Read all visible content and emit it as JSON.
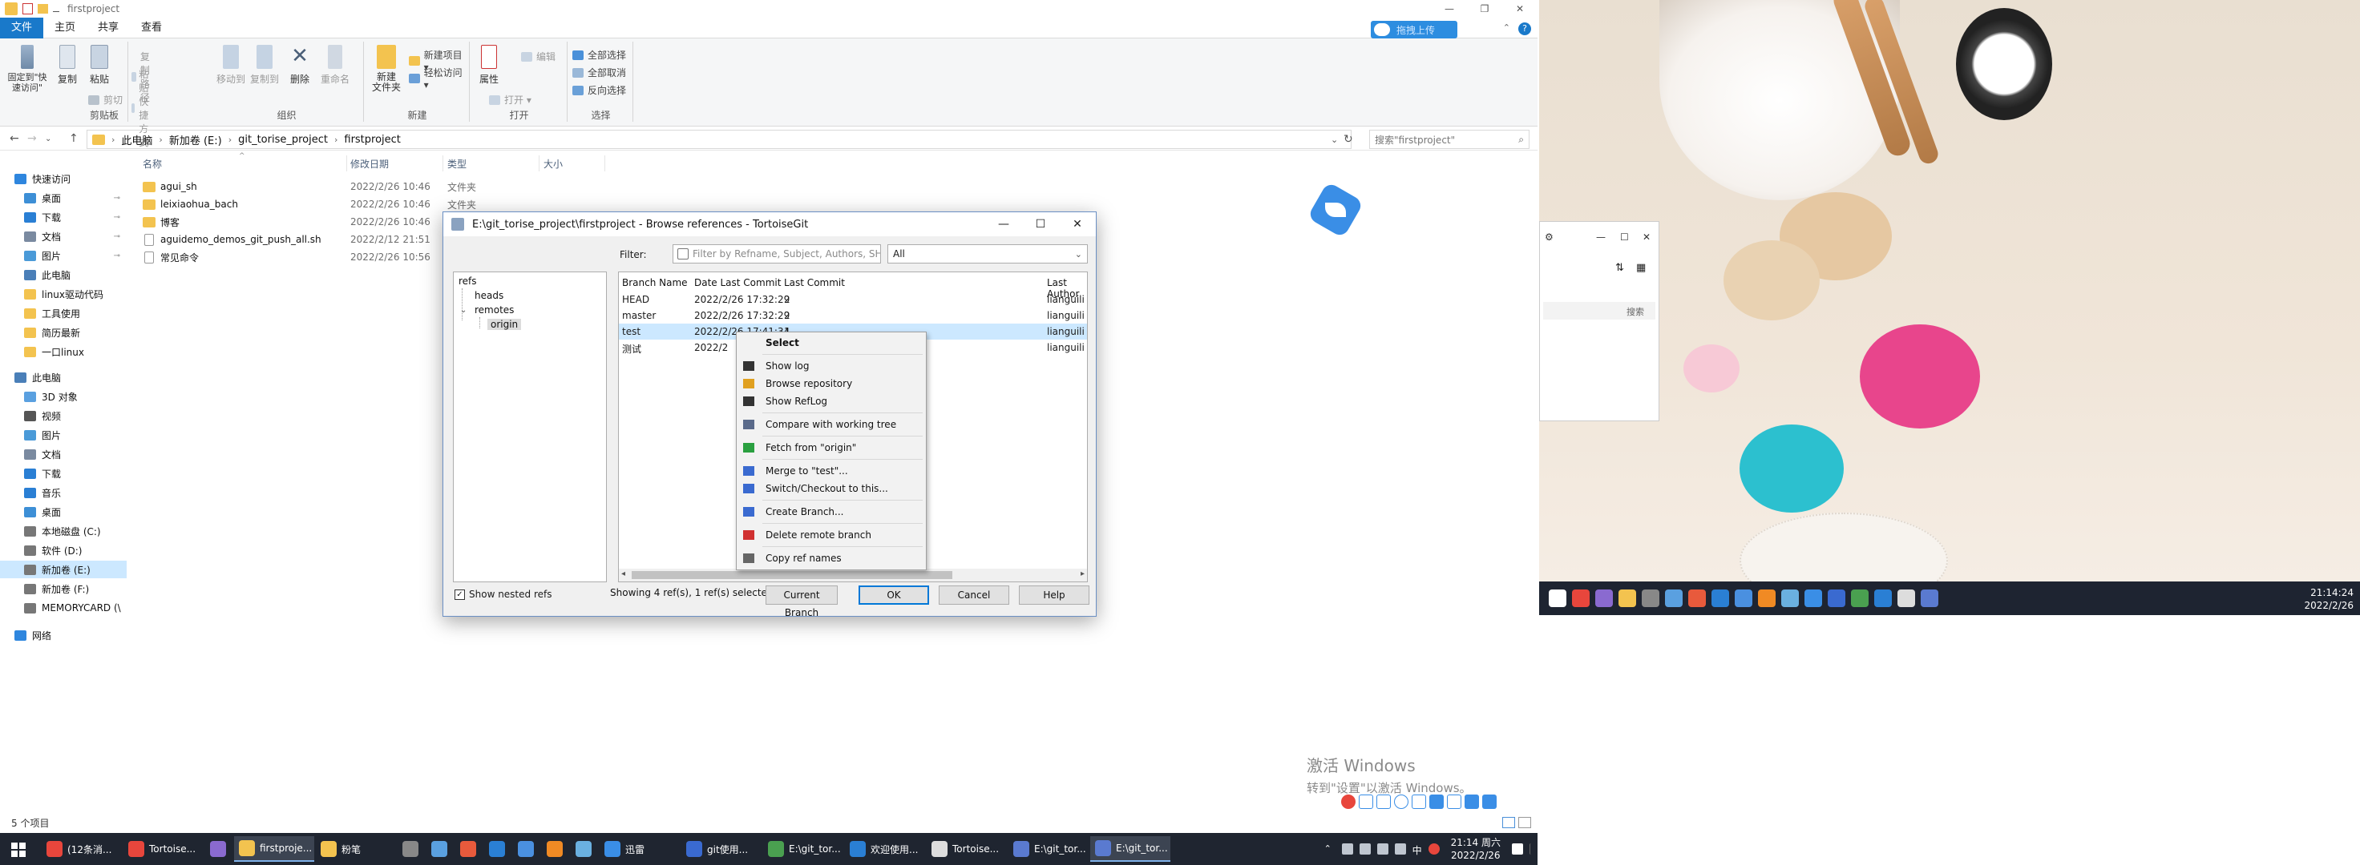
{
  "explorer": {
    "title": "firstproject",
    "window_controls": [
      "—",
      "❐",
      "✕"
    ],
    "tabs": [
      "文件",
      "主页",
      "共享",
      "查看"
    ],
    "upload_label": "拖拽上传",
    "ribbon": {
      "clipboard": {
        "pin": "固定到\"快速访问\"",
        "copy": "复制",
        "paste": "粘贴",
        "copy_path": "复制路径",
        "paste_shortcut": "粘贴快捷方式",
        "cut": "剪切",
        "label": "剪贴板"
      },
      "organize": {
        "move_to": "移动到",
        "copy_to": "复制到",
        "delete": "删除",
        "rename": "重命名",
        "label": "组织"
      },
      "new": {
        "new_folder": "新建\n文件夹",
        "new_item": "新建项目 ▾",
        "easy_access": "轻松访问 ▾",
        "label": "新建"
      },
      "open": {
        "properties": "属性",
        "open": "打开 ▾",
        "edit": "编辑",
        "label": "打开"
      },
      "select": {
        "select_all": "全部选择",
        "select_none": "全部取消",
        "invert": "反向选择",
        "label": "选择"
      }
    },
    "address": {
      "crumbs": [
        "此电脑",
        "新加卷 (E:)",
        "git_torise_project",
        "firstproject"
      ],
      "search_placeholder": "搜索\"firstproject\""
    },
    "nav": [
      {
        "label": "快速访问",
        "color": "#2e86de"
      },
      {
        "label": "桌面",
        "color": "#3d8fd6",
        "pin": "📌"
      },
      {
        "label": "下载",
        "color": "#2a7fd4",
        "pin": "📌"
      },
      {
        "label": "文档",
        "color": "#7a8aa0",
        "pin": "📌"
      },
      {
        "label": "图片",
        "color": "#4a9ad8",
        "pin": "📌"
      },
      {
        "label": "此电脑",
        "color": "#4a7fb8"
      },
      {
        "label": "linux驱动代码",
        "color": "#f3c34f"
      },
      {
        "label": "工具使用",
        "color": "#f3c34f"
      },
      {
        "label": "简历最新",
        "color": "#f3c34f"
      },
      {
        "label": "一口linux",
        "color": "#f3c34f"
      },
      {
        "label": "此电脑",
        "color": "#4a7fb8"
      },
      {
        "label": "3D 对象",
        "color": "#5aa0e0"
      },
      {
        "label": "视频",
        "color": "#555"
      },
      {
        "label": "图片",
        "color": "#4a9ad8"
      },
      {
        "label": "文档",
        "color": "#7a8aa0"
      },
      {
        "label": "下载",
        "color": "#2a7fd4"
      },
      {
        "label": "音乐",
        "color": "#2a7fd4"
      },
      {
        "label": "桌面",
        "color": "#3d8fd6"
      },
      {
        "label": "本地磁盘 (C:)",
        "color": "#777"
      },
      {
        "label": "软件 (D:)",
        "color": "#777"
      },
      {
        "label": "新加卷 (E:)",
        "color": "#777"
      },
      {
        "label": "新加卷 (F:)",
        "color": "#777"
      },
      {
        "label": "MEMORYCARD (\\",
        "color": "#777"
      },
      {
        "label": "网络",
        "color": "#2e86de"
      }
    ],
    "columns": [
      "名称",
      "修改日期",
      "类型",
      "大小"
    ],
    "files": [
      {
        "name": "agui_sh",
        "date": "2022/2/26 10:46",
        "type": "文件夹",
        "kind": "folder"
      },
      {
        "name": "leixiaohua_bach",
        "date": "2022/2/26 10:46",
        "type": "文件夹",
        "kind": "folder"
      },
      {
        "name": "博客",
        "date": "2022/2/26 10:46",
        "type": "文件夹",
        "kind": "folder"
      },
      {
        "name": "aguidemo_demos_git_push_all.sh",
        "date": "2022/2/12 21:51",
        "type": "",
        "kind": "file"
      },
      {
        "name": "常见命令",
        "date": "2022/2/26 10:56",
        "type": "",
        "kind": "file"
      }
    ],
    "status": "5 个项目",
    "watermark": {
      "line1": "激活 Windows",
      "line2": "转到\"设置\"以激活 Windows。"
    }
  },
  "dialog": {
    "title": "E:\\git_torise_project\\firstproject - Browse references - TortoiseGit",
    "tree": {
      "root": "refs",
      "heads": "heads",
      "remotes": "remotes",
      "origin": "origin"
    },
    "filter_label": "Filter:",
    "filter_placeholder": "Filter by Refname, Subject, Authors, SHA",
    "filter_scope": "All",
    "columns": [
      "Branch Name",
      "Date Last Commit",
      "Last Commit",
      "Last Author"
    ],
    "rows": [
      {
        "name": "HEAD",
        "date": "2022/2/26 17:32:29",
        "commit": "2",
        "author": "lianguili"
      },
      {
        "name": "master",
        "date": "2022/2/26 17:32:29",
        "commit": "2",
        "author": "lianguili"
      },
      {
        "name": "test",
        "date": "2022/2/26 17:41:34",
        "commit": "1",
        "author": "lianguili",
        "selected": true
      },
      {
        "name": "测试",
        "date": "2022/2",
        "commit": "",
        "author": "lianguili"
      }
    ],
    "show_nested": "Show nested refs",
    "showing": "Showing 4 ref(s), 1 ref(s) selected",
    "buttons": {
      "current_branch": "Current Branch",
      "ok": "OK",
      "cancel": "Cancel",
      "help": "Help"
    }
  },
  "context_menu": {
    "items": [
      {
        "label": "Select",
        "icon": "none",
        "bold": true
      },
      {
        "label": "Show log",
        "icon": "log-icon",
        "color": "#333"
      },
      {
        "label": "Browse repository",
        "icon": "repo-browser-icon",
        "color": "#e0a020"
      },
      {
        "label": "Show RefLog",
        "icon": "reflog-icon",
        "color": "#333"
      },
      {
        "label": "Compare with working tree",
        "icon": "compare-icon",
        "color": "#5a6a8a"
      },
      {
        "label": "Fetch from \"origin\"",
        "icon": "fetch-icon",
        "color": "#2aa040"
      },
      {
        "label": "Merge to \"test\"...",
        "icon": "merge-icon",
        "color": "#3a6ad0"
      },
      {
        "label": "Switch/Checkout to this...",
        "icon": "checkout-icon",
        "color": "#3a6ad0"
      },
      {
        "label": "Create Branch...",
        "icon": "create-branch-icon",
        "color": "#3a6ad0"
      },
      {
        "label": "Delete remote branch",
        "icon": "delete-icon",
        "color": "#d03030"
      },
      {
        "label": "Copy ref names",
        "icon": "copy-icon",
        "color": "#666"
      }
    ]
  },
  "taskbar": {
    "apps": [
      {
        "label": "(12条消...",
        "color": "#e8463c"
      },
      {
        "label": "Tortoise...",
        "color": "#e8463c"
      },
      {
        "label": "",
        "color": "#8a6ad0"
      },
      {
        "label": "firstproje...",
        "color": "#f3c34f",
        "active": true
      },
      {
        "label": "粉笔",
        "color": "#f3c34f"
      },
      {
        "label": "",
        "color": "#888"
      },
      {
        "label": "",
        "color": "#5aa0e0"
      },
      {
        "label": "",
        "color": "#e85a3c"
      },
      {
        "label": "",
        "color": "#2a7fd4"
      },
      {
        "label": "",
        "color": "#4a90e0"
      },
      {
        "label": "",
        "color": "#f08a24"
      },
      {
        "label": "",
        "color": "#6ab0e0"
      },
      {
        "label": "迅雷",
        "color": "#3a8ee6"
      },
      {
        "label": "git使用...",
        "color": "#3a6ad0"
      },
      {
        "label": "E:\\git_tor...",
        "color": "#4aa050"
      },
      {
        "label": "欢迎使用...",
        "color": "#2a7fd4"
      },
      {
        "label": "Tortoise...",
        "color": "#ddd"
      },
      {
        "label": "E:\\git_tor...",
        "color": "#5a7ad0"
      },
      {
        "label": "E:\\git_tor...",
        "color": "#5a7ad0",
        "active": true
      }
    ],
    "clock_time": "21:14 周六",
    "clock_date": "2022/2/26",
    "ime": "中"
  },
  "right_screen": {
    "small_window_search": "搜索",
    "clock_time": "21:14:24",
    "clock_date": "2022/2/26",
    "taskbar_icons": [
      "#fff",
      "#e8463c",
      "#8a6ad0",
      "#f3c34f",
      "#888",
      "#5aa0e0",
      "#e85a3c",
      "#2a7fd4",
      "#4a90e0",
      "#f08a24",
      "#6ab0e0",
      "#3a8ee6",
      "#3a6ad0",
      "#4aa050",
      "#2a7fd4",
      "#ddd",
      "#5a7ad0"
    ]
  }
}
